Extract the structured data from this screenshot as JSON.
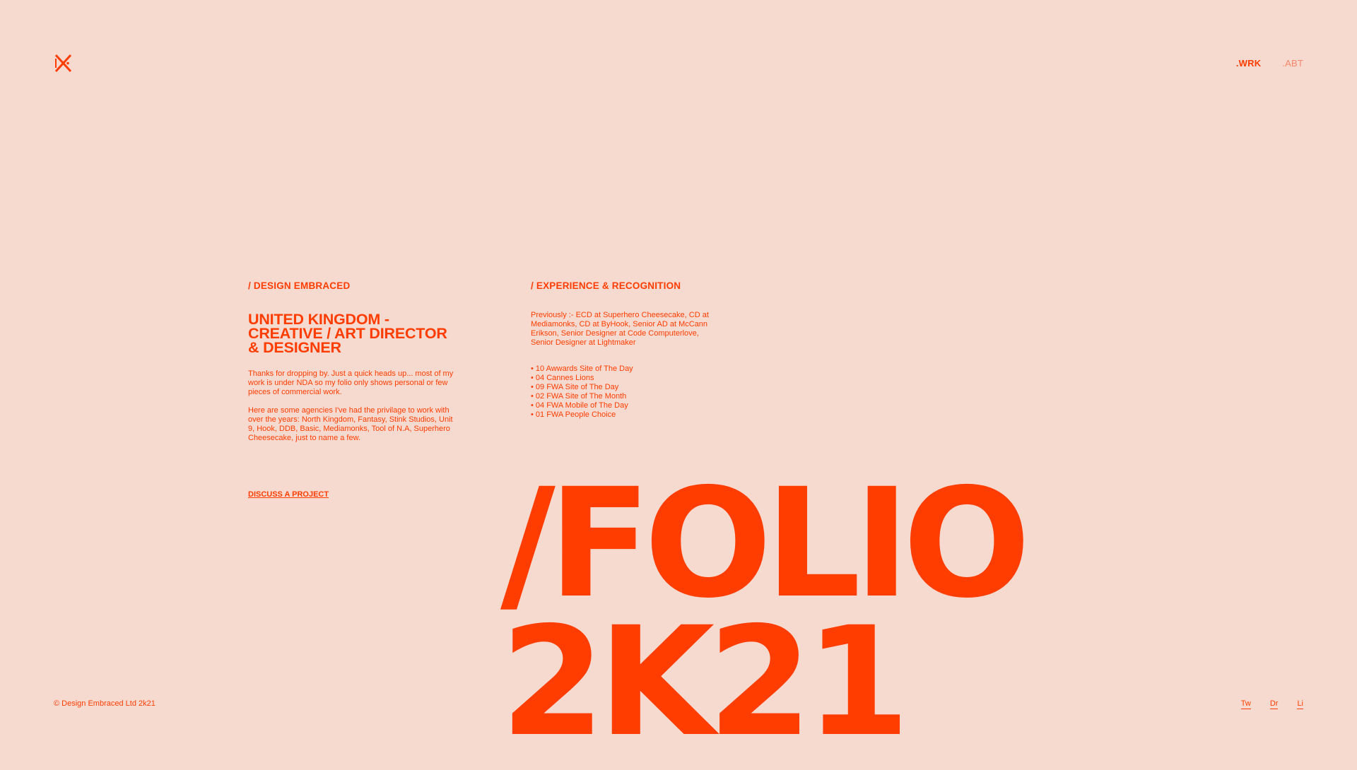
{
  "brand": {
    "logo_icon": "dk-monogram-icon",
    "accent_color": "#ff3d00",
    "background_color": "#f6d9cf"
  },
  "nav": {
    "items": [
      {
        "label": ".WRK",
        "active": true
      },
      {
        "label": ".ABT",
        "active": false
      }
    ]
  },
  "about": {
    "heading": "/ DESIGN EMBRACED",
    "title": "UNITED KINGDOM - CREATIVE / ART DIRECTOR & DESIGNER",
    "intro": "Thanks for dropping by. Just a quick heads up... most of my work is under NDA so my folio only shows personal or few pieces of commercial work.",
    "agencies": "Here are some agencies I've had the privilage to work with over the years: North Kingdom, Fantasy, Stink Studios, Unit 9, Hook, DDB, Basic, Mediamonks, Tool of N.A, Superhero Cheesecake, just to name a few.",
    "cta": "DISCUSS A PROJECT"
  },
  "experience": {
    "heading": "/ EXPERIENCE & RECOGNITION",
    "roles": "Previously :- ECD at Superhero Cheesecake, CD at Mediamonks, CD at ByHook, Senior AD at McCann Erikson, Senior Designer at Code Computerlove, Senior Designer at Lightmaker",
    "awards": [
      "• 10 Awwards Site of The Day",
      "• 04 Cannes Lions",
      "• 09 FWA Site of The Day",
      "• 02 FWA Site of The Month",
      "• 04 FWA Mobile of The Day",
      "• 01 FWA People Choice"
    ]
  },
  "hero": {
    "line1": "/FOLIO",
    "line2": "2K21"
  },
  "footer": {
    "copyright": "© Design Embraced Ltd 2k21",
    "social": [
      "Tw",
      "Dr",
      "Li"
    ]
  }
}
